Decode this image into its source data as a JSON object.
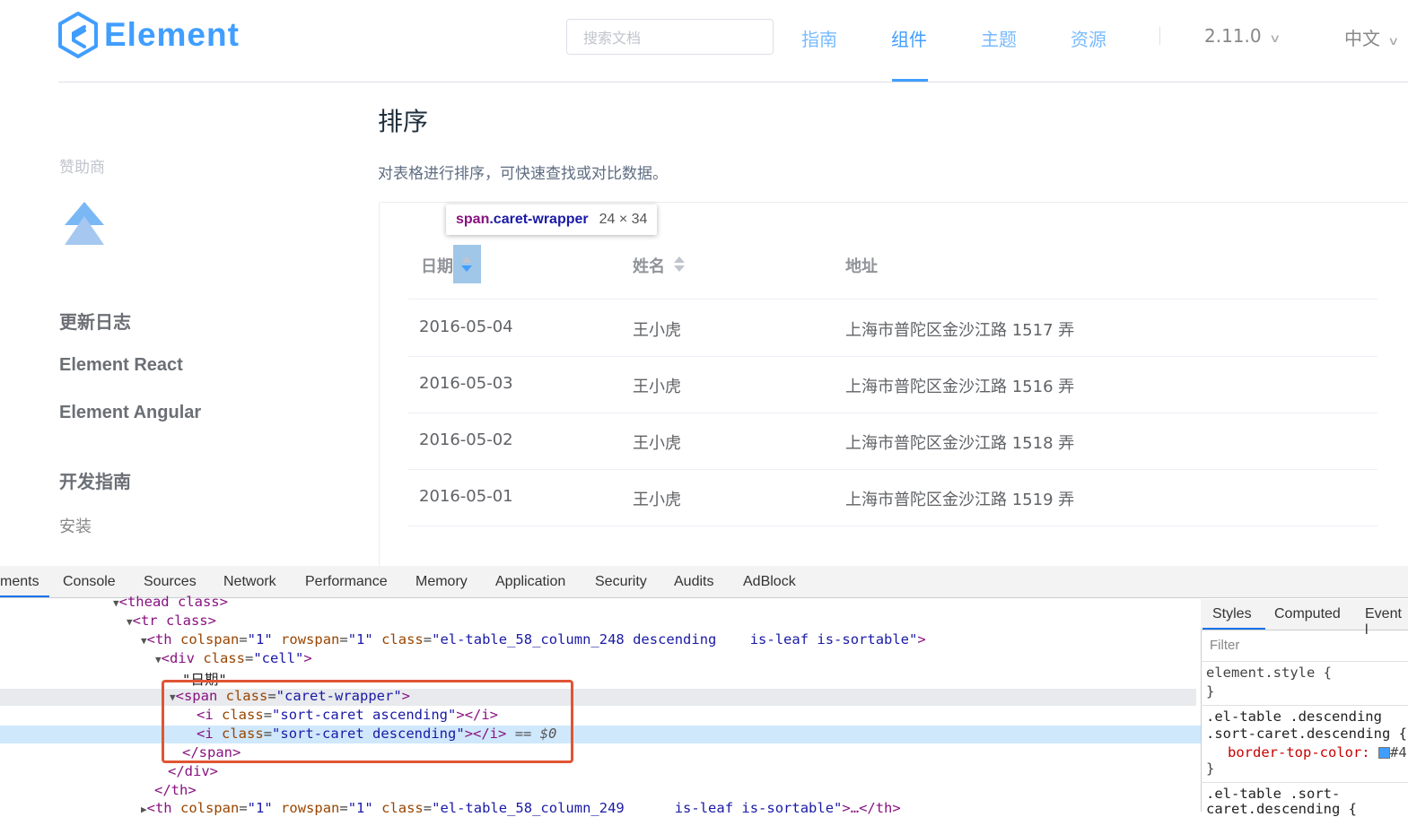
{
  "header": {
    "logo_text": "Element",
    "search_placeholder": "搜索文档",
    "nav": [
      "指南",
      "组件",
      "主题",
      "资源"
    ],
    "active_nav": "组件",
    "version": "2.11.0",
    "language": "中文"
  },
  "sidebar": {
    "sponsor_label": "赞助商",
    "links": [
      "更新日志",
      "Element React",
      "Element Angular",
      "开发指南"
    ],
    "sub_item": "安装"
  },
  "content": {
    "title": "排序",
    "description": "对表格进行排序，可快速查找或对比数据。",
    "tooltip": {
      "tag": "span",
      "class": ".caret-wrapper",
      "size": "24 × 34"
    },
    "table": {
      "headers": [
        "日期",
        "姓名",
        "地址"
      ],
      "rows": [
        [
          "2016-05-04",
          "王小虎",
          "上海市普陀区金沙江路 1517 弄"
        ],
        [
          "2016-05-03",
          "王小虎",
          "上海市普陀区金沙江路 1516 弄"
        ],
        [
          "2016-05-02",
          "王小虎",
          "上海市普陀区金沙江路 1518 弄"
        ],
        [
          "2016-05-01",
          "王小虎",
          "上海市普陀区金沙江路 1519 弄"
        ]
      ]
    }
  },
  "devtools": {
    "tabs": [
      "ments",
      "Console",
      "Sources",
      "Network",
      "Performance",
      "Memory",
      "Application",
      "Security",
      "Audits",
      "AdBlock"
    ],
    "active_tab": "ments",
    "dom": {
      "l1": "thead class",
      "l2": "tr class",
      "l3_tag": "th",
      "l3_attr1": "colspan",
      "l3_val1": "1",
      "l3_attr2": "rowspan",
      "l3_val2": "1",
      "l3_attr3": "class",
      "l3_val3": "el-table_58_column_248 descending    is-leaf is-sortable",
      "l4_tag": "div",
      "l4_val": "cell",
      "l5_text": "\"日期\"",
      "l6_tag": "span",
      "l6_val": "caret-wrapper",
      "l7_val": "sort-caret ascending",
      "l8_val": "sort-caret descending",
      "l8_suffix": "== $0",
      "l9": "</span>",
      "l10": "</div>",
      "l11": "</th>",
      "l12_val3": "el-table_58_column_249      is-leaf is-sortable",
      "l12_tail": "…</th>"
    },
    "styles": {
      "tabs": [
        "Styles",
        "Computed",
        "Event l"
      ],
      "filter_placeholder": "Filter",
      "rule1": "element.style {",
      "rule1_close": "}",
      "rule2_sel1": ".el-table .descending",
      "rule2_sel2": ".sort-caret.descending {",
      "rule2_prop": "border-top-color:",
      "rule2_val": "#4",
      "rule2_close": "}",
      "rule3_sel1": ".el-table .sort-",
      "rule3_sel2": "caret.descending {"
    },
    "colors": {
      "accent": "#409eff",
      "highlight_box": "#e05534"
    }
  }
}
